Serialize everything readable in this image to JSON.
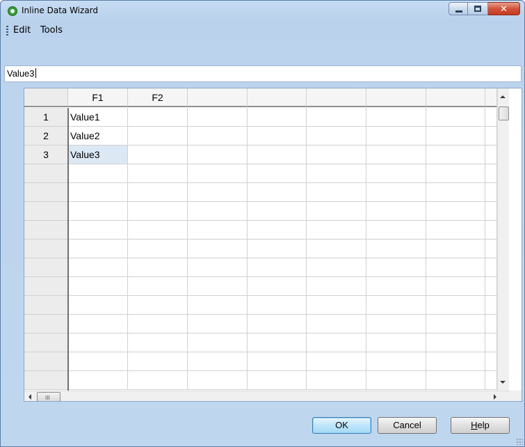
{
  "window": {
    "title": "Inline Data Wizard",
    "close_symbol": "✕"
  },
  "menu": {
    "items": [
      "Edit",
      "Tools"
    ]
  },
  "value_input": {
    "value": "Value3"
  },
  "grid": {
    "columns": [
      "F1",
      "F2",
      "",
      "",
      "",
      "",
      "",
      ""
    ],
    "rows": [
      {
        "num": "1",
        "cells": [
          "Value1",
          ""
        ]
      },
      {
        "num": "2",
        "cells": [
          "Value2",
          ""
        ]
      },
      {
        "num": "3",
        "cells": [
          "Value3",
          ""
        ]
      }
    ],
    "selected_cell": {
      "row": 3,
      "col": "F1"
    },
    "scroll_thumb_grip": "III"
  },
  "buttons": {
    "ok": "OK",
    "cancel": "Cancel",
    "help_first": "H",
    "help_rest": "elp"
  },
  "colors": {
    "title_gradient_top": "#c6dcf3",
    "close_button": "#c43b23",
    "selected_cell": "#dde8f5",
    "app_icon": "#3a9a3a"
  },
  "icons": [
    "app-icon",
    "minimize-icon",
    "maximize-icon",
    "close-icon",
    "menu-grip-icon",
    "scroll-up-icon",
    "scroll-down-icon",
    "scroll-left-icon",
    "scroll-right-icon",
    "resize-grip-icon"
  ]
}
